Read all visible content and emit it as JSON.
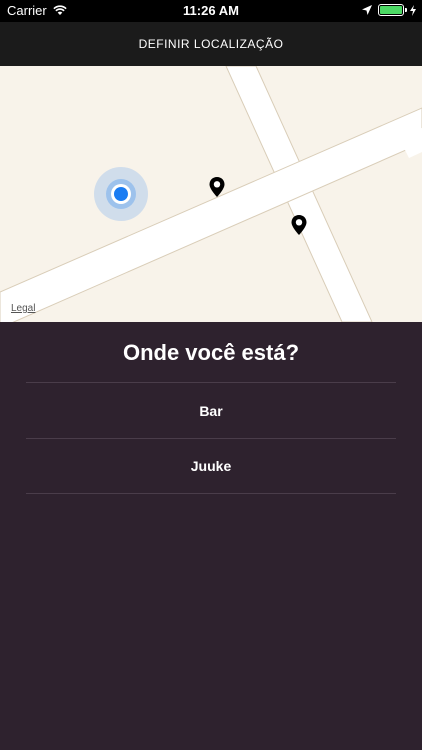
{
  "status_bar": {
    "carrier": "Carrier",
    "time": "11:26 AM"
  },
  "nav": {
    "title": "DEFINIR LOCALIZAÇÃO"
  },
  "map": {
    "legal_label": "Legal",
    "user_location_color": "#1a7cf2",
    "pin_color": "#000000"
  },
  "panel": {
    "title": "Onde você está?",
    "locations": [
      {
        "label": "Bar"
      },
      {
        "label": "Juuke"
      }
    ]
  }
}
